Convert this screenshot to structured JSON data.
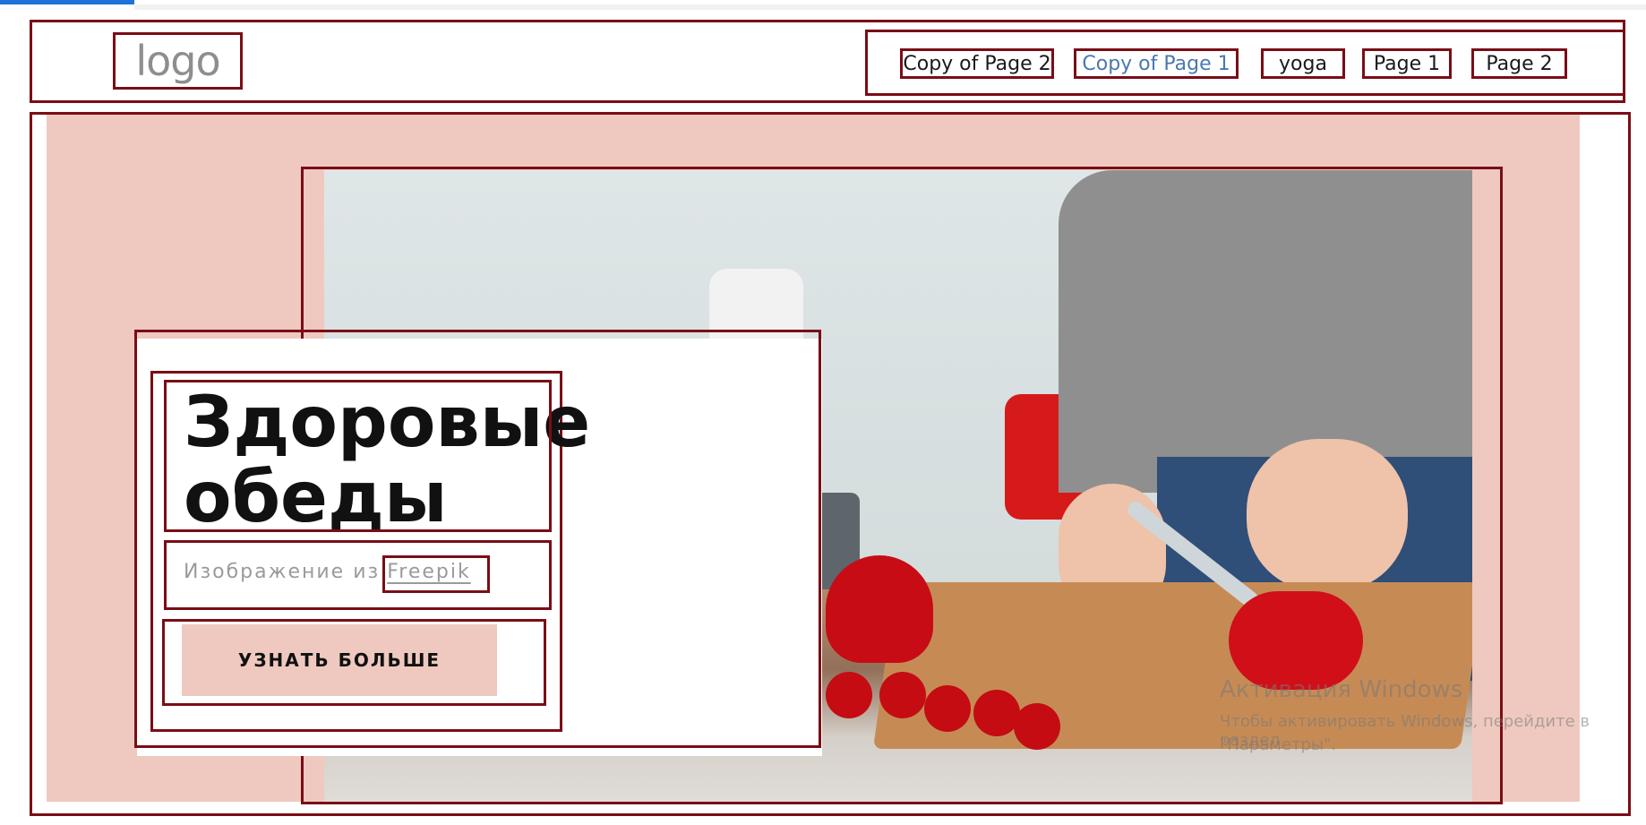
{
  "header": {
    "logo_text": "logo",
    "nav": [
      {
        "label": "Copy of Page 2",
        "active": false
      },
      {
        "label": "Copy of Page 1",
        "active": true
      },
      {
        "label": "yoga",
        "active": false
      },
      {
        "label": "Page 1",
        "active": false
      },
      {
        "label": "Page 2",
        "active": false
      }
    ]
  },
  "hero": {
    "title_line1": "Здоровые",
    "title_line2": "обеды",
    "caption_prefix": "Изображение из",
    "caption_link": "Freepik",
    "cta_label": "УЗНАТЬ БОЛЬШЕ"
  },
  "overlay": {
    "windows_activation": {
      "title": "Активация Windows",
      "line1": "Чтобы активировать Windows, перейдите в раздел",
      "line2": "\"Параметры\"."
    }
  }
}
